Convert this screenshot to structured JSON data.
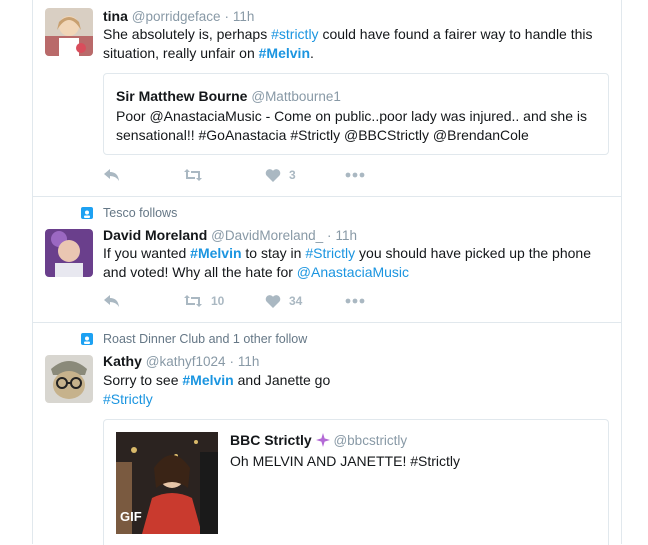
{
  "tweets": [
    {
      "name": "tina",
      "handle": "@porridgeface",
      "time": "11h",
      "text_parts": [
        "She absolutely is, perhaps ",
        "#strictly",
        " could have found a fairer way to handle this situation, really unfair on ",
        "#Melvin",
        "."
      ],
      "quote": {
        "name": "Sir Matthew Bourne",
        "handle": "@Mattbourne1",
        "text": "Poor @AnastaciaMusic - Come on public..poor lady was injured.. and she is sensational!! #GoAnastacia #Strictly @BBCStrictly @BrendanCole"
      },
      "likes": "3"
    },
    {
      "context": "Tesco follows",
      "name": "David Moreland",
      "handle": "@DavidMoreland_",
      "time": "11h",
      "text_parts": [
        "If you wanted ",
        "#Melvin",
        " to stay in ",
        "#Strictly",
        " you should have picked up the phone and voted! Why all the hate for ",
        "@AnastaciaMusic"
      ],
      "retweets": "10",
      "likes": "34"
    },
    {
      "context": "Roast Dinner Club and 1 other follow",
      "name": "Kathy",
      "handle": "@kathyf1024",
      "time": "11h",
      "text_parts": [
        "Sorry to see ",
        "#Melvin",
        " and Janette go",
        "#Strictly"
      ],
      "quote": {
        "name": "BBC Strictly",
        "handle": "@bbcstrictly",
        "text": "Oh MELVIN AND JANETTE! #Strictly",
        "gif_label": "GIF"
      }
    }
  ],
  "separator": "·",
  "icons": [
    "reply-icon",
    "retweet-icon",
    "like-icon",
    "more-icon",
    "follow-context-icon",
    "sparkle-icon"
  ],
  "colors": {
    "link": "#1b95e0",
    "muted": "#8899a6",
    "border": "#e1e8ed"
  }
}
